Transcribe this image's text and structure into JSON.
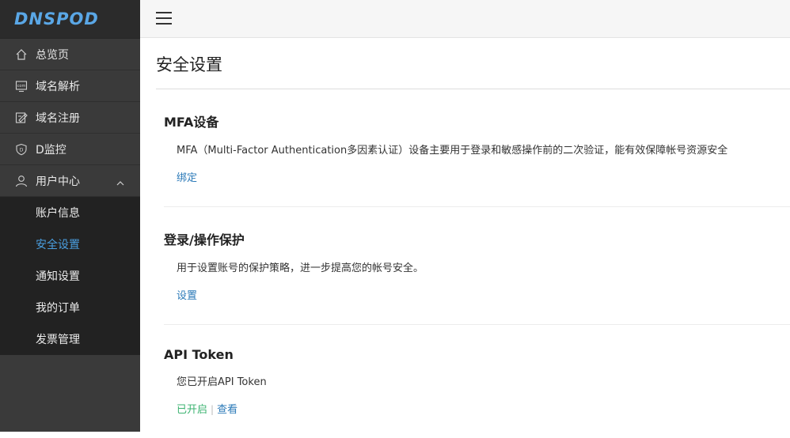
{
  "brand": {
    "logo_text": "DNSPOD"
  },
  "sidebar": {
    "items": [
      {
        "label": "总览页",
        "icon": "home-icon"
      },
      {
        "label": "域名解析",
        "icon": "dns-icon"
      },
      {
        "label": "域名注册",
        "icon": "edit-icon"
      },
      {
        "label": "D监控",
        "icon": "shield-icon"
      },
      {
        "label": "用户中心",
        "icon": "user-icon"
      }
    ],
    "user_center_sub": [
      {
        "label": "账户信息"
      },
      {
        "label": "安全设置"
      },
      {
        "label": "通知设置"
      },
      {
        "label": "我的订单"
      },
      {
        "label": "发票管理"
      }
    ],
    "active_sub": "安全设置",
    "colors": {
      "active": "#4a9fe0",
      "bg": "#3a3a3a",
      "sub_bg": "#222222"
    }
  },
  "main": {
    "title": "安全设置",
    "sections": [
      {
        "heading": "MFA设备",
        "desc": "MFA（Multi-Factor Authentication多因素认证）设备主要用于登录和敏感操作前的二次验证，能有效保障帐号资源安全",
        "action": "绑定"
      },
      {
        "heading": "登录/操作保护",
        "desc": "用于设置账号的保护策略，进一步提高您的帐号安全。",
        "action": "设置"
      },
      {
        "heading": "API Token",
        "desc": "您已开启API Token",
        "status": "已开启",
        "action": "查看"
      }
    ]
  }
}
